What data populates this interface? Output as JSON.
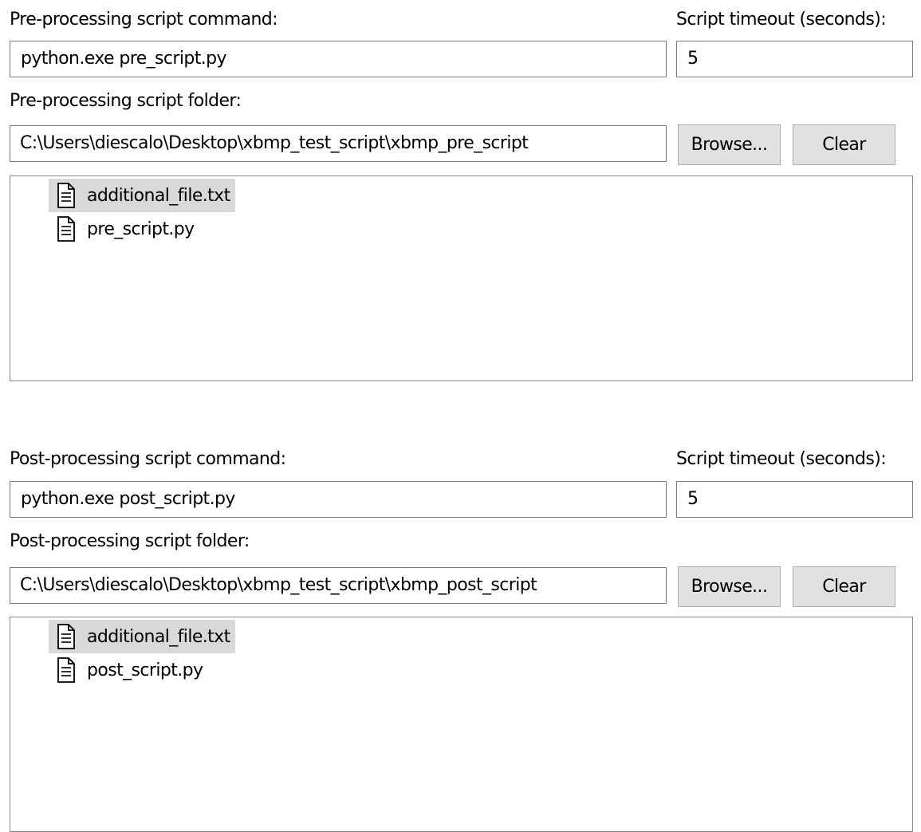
{
  "pre": {
    "command_label": "Pre-processing script command:",
    "timeout_label": "Script timeout (seconds):",
    "command_value": "python.exe pre_script.py",
    "timeout_value": "5",
    "folder_label": "Pre-processing script folder:",
    "folder_value": "C:\\Users\\diescalo\\Desktop\\xbmp_test_script\\xbmp_pre_script",
    "browse_label": "Browse...",
    "clear_label": "Clear",
    "files": [
      {
        "name": "additional_file.txt",
        "icon": "text-file-icon",
        "selected": true
      },
      {
        "name": "pre_script.py",
        "icon": "text-file-icon",
        "selected": false
      }
    ]
  },
  "post": {
    "command_label": "Post-processing script command:",
    "timeout_label": "Script timeout (seconds):",
    "command_value": "python.exe post_script.py",
    "timeout_value": "5",
    "folder_label": "Post-processing script folder:",
    "folder_value": "C:\\Users\\diescalo\\Desktop\\xbmp_test_script\\xbmp_post_script",
    "browse_label": "Browse...",
    "clear_label": "Clear",
    "files": [
      {
        "name": "additional_file.txt",
        "icon": "text-file-icon",
        "selected": true
      },
      {
        "name": "post_script.py",
        "icon": "text-file-icon",
        "selected": false
      }
    ]
  },
  "colors": {
    "selected_row": "#d9d9d9",
    "button_bg": "#e1e1e1",
    "field_border": "#7a7a7a"
  }
}
